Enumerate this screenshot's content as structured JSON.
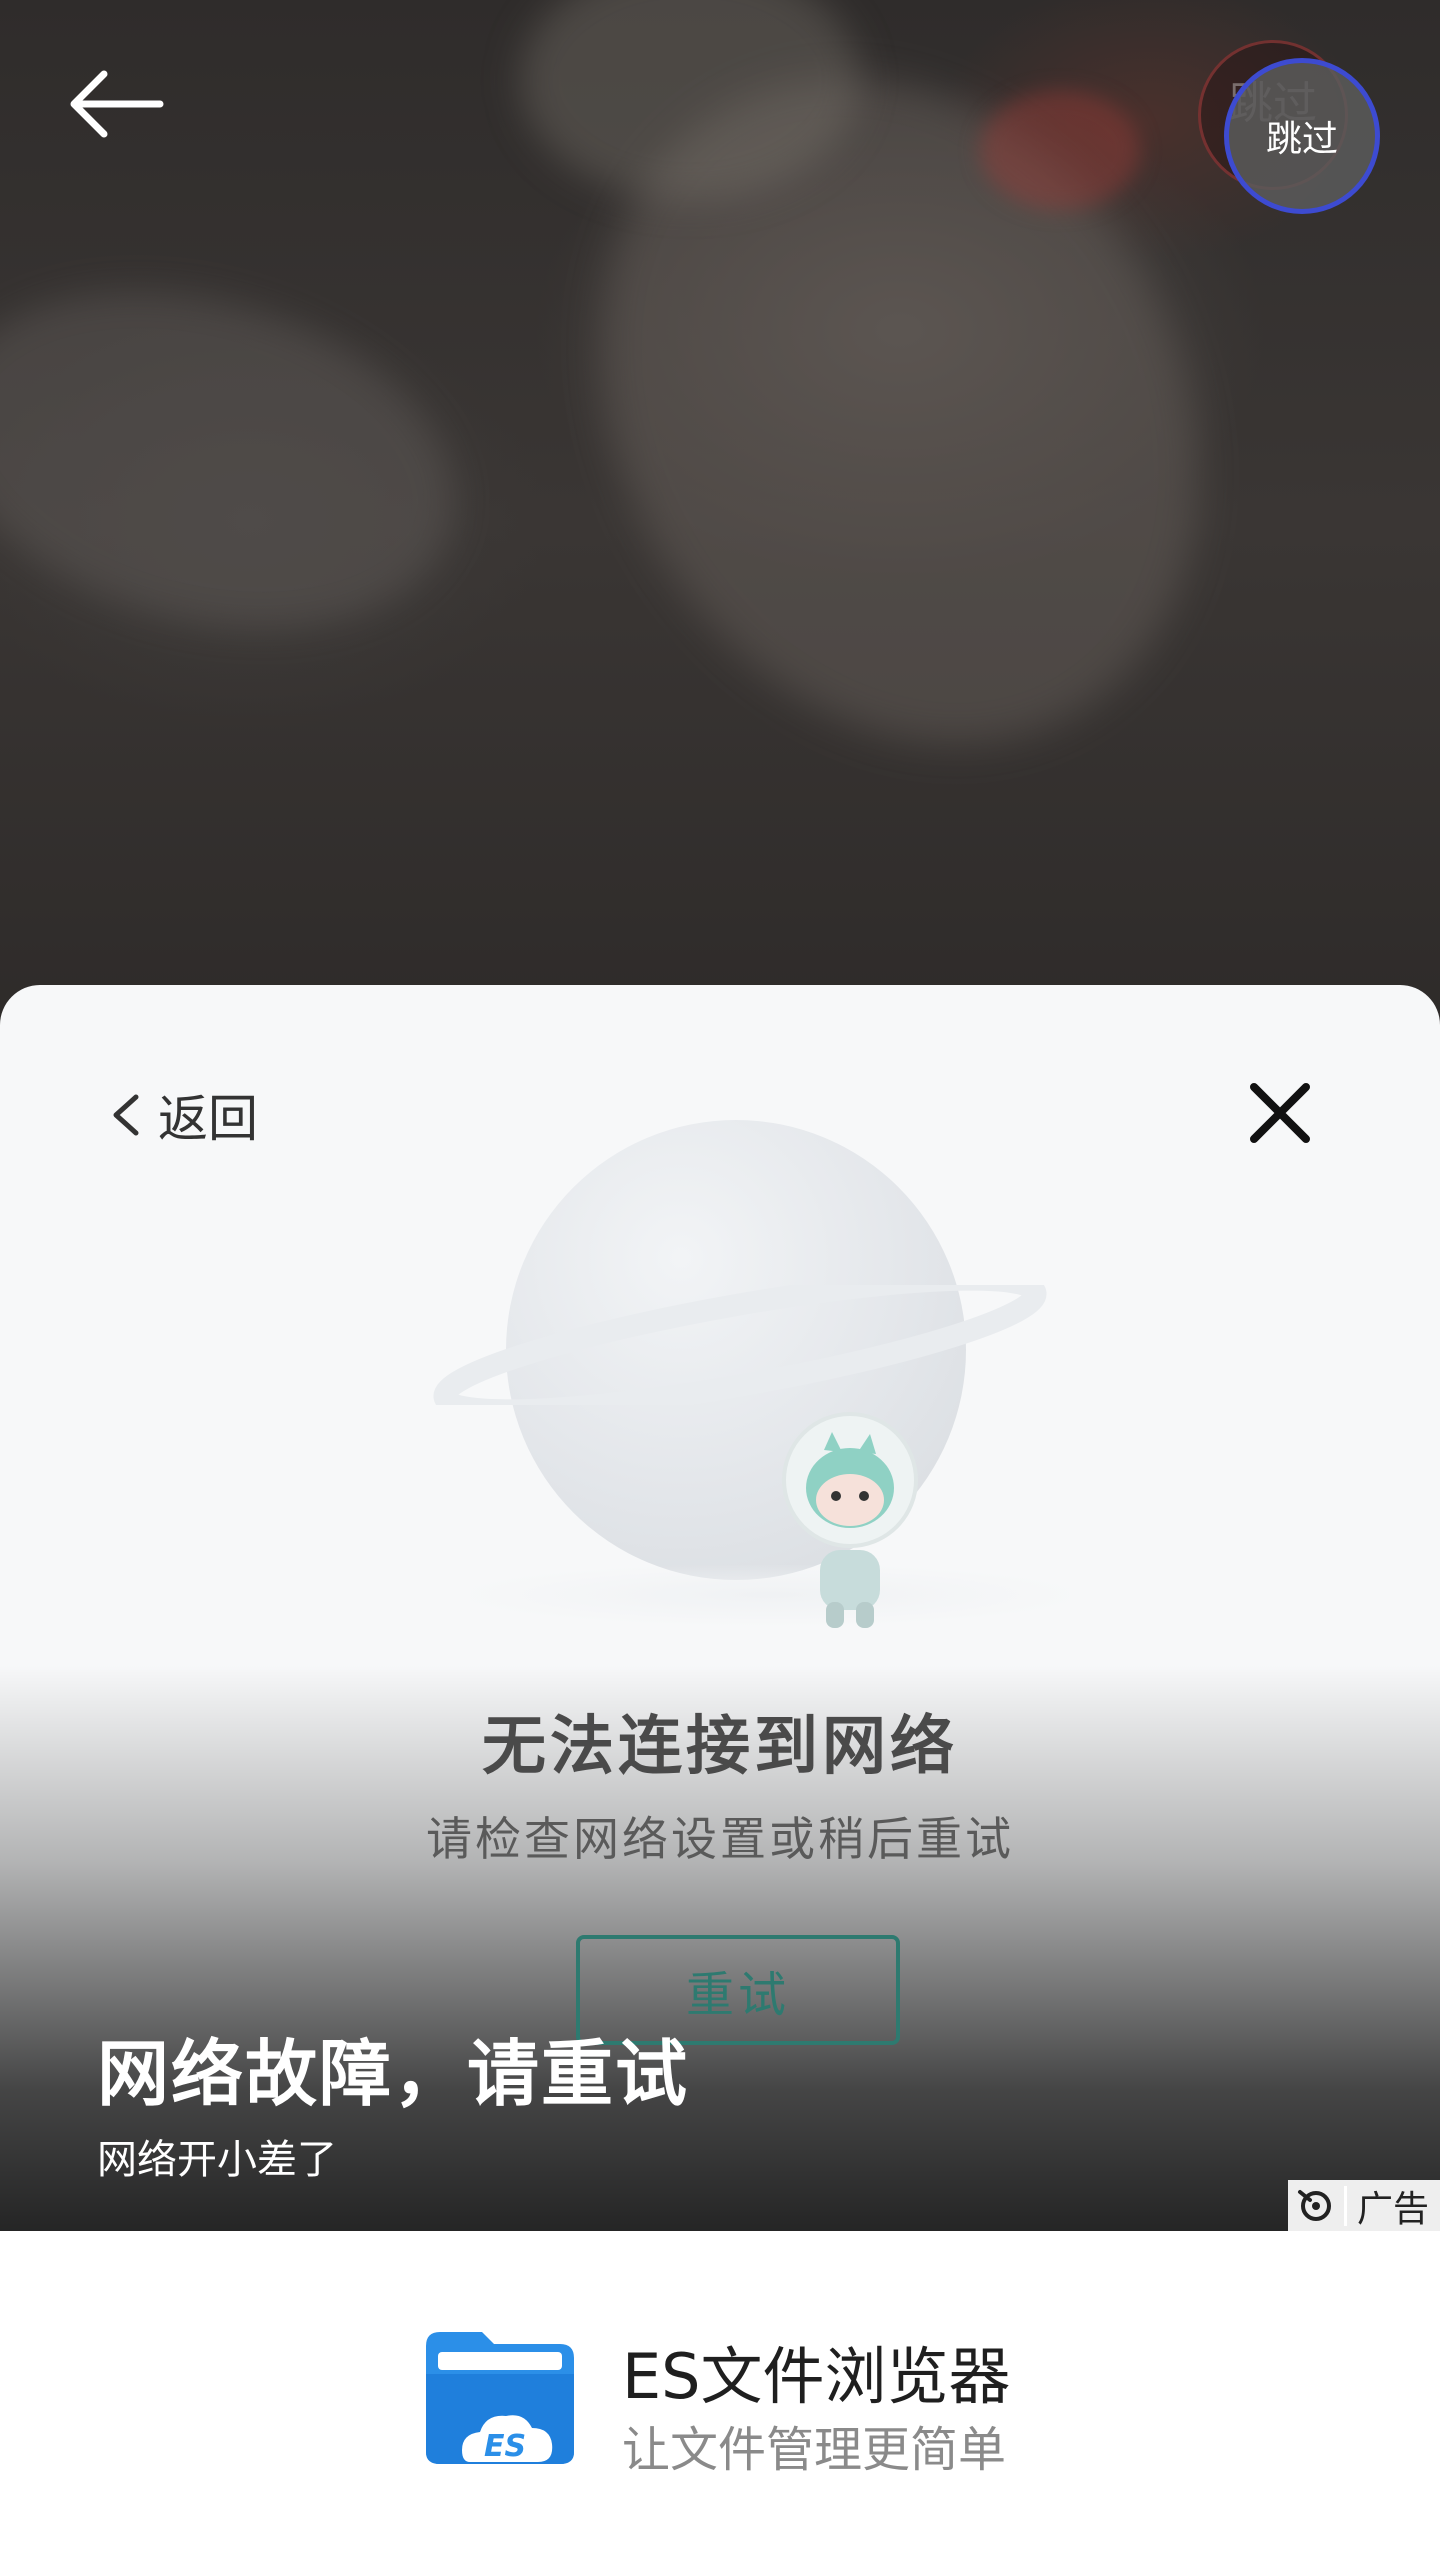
{
  "topbar": {
    "back_icon": "arrow-left-icon",
    "skip_label": "跳过",
    "skip_ghost_label": "跳过"
  },
  "ad_card": {
    "back_label": "返回",
    "close_icon": "close-icon",
    "error_title": "无法连接到网络",
    "error_subtitle": "请检查网络设置或稍后重试",
    "retry_label": "重试",
    "overlay_title": "网络故障，请重试",
    "overlay_subtitle": "网络开小差了",
    "ad_badge_label": "广告"
  },
  "app": {
    "name": "ES文件浏览器",
    "description": "让文件管理更简单",
    "icon": "es-file-explorer-icon"
  },
  "colors": {
    "skip_ring": "#3d4bd1",
    "retry_accent": "#2e7a70",
    "app_icon_blue": "#2b8fe8"
  }
}
